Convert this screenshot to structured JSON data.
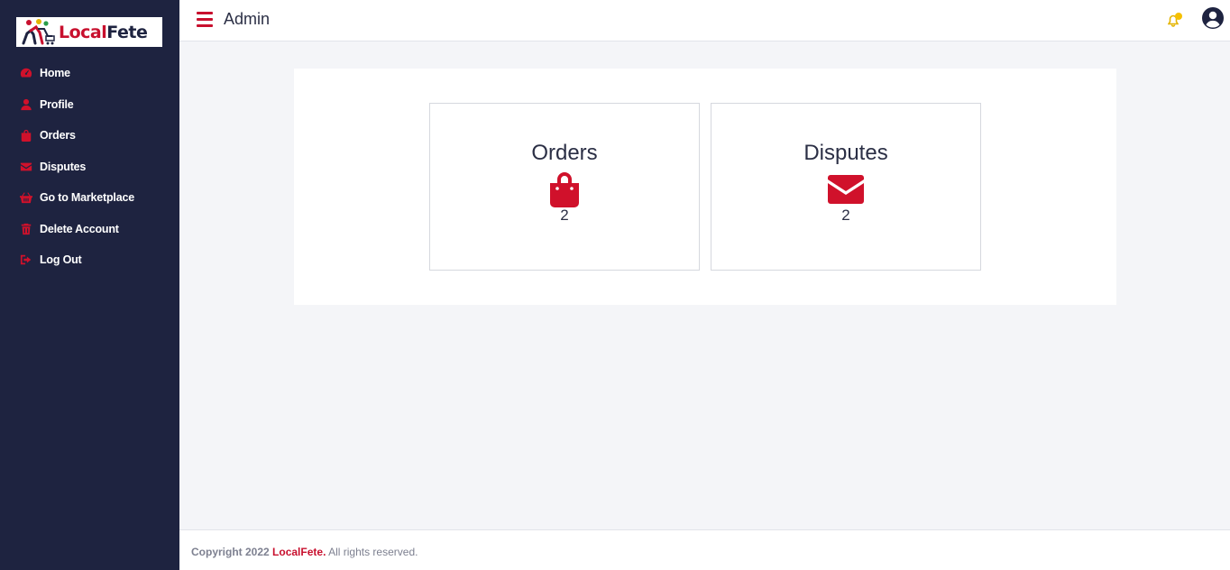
{
  "brand": {
    "part1": "Local",
    "part2": "Fete"
  },
  "colors": {
    "sidebar_bg": "#1e2340",
    "accent": "#d0112b",
    "notification": "#f5c000",
    "page_bg": "#f4f5f8"
  },
  "sidebar": {
    "items": [
      {
        "label": "Home",
        "icon": "dashboard-icon"
      },
      {
        "label": "Profile",
        "icon": "user-icon"
      },
      {
        "label": "Orders",
        "icon": "shopping-bag-icon"
      },
      {
        "label": "Disputes",
        "icon": "envelope-icon"
      },
      {
        "label": "Go to Marketplace",
        "icon": "basket-icon"
      },
      {
        "label": "Delete Account",
        "icon": "trash-icon"
      },
      {
        "label": "Log Out",
        "icon": "sign-out-icon"
      }
    ]
  },
  "header": {
    "title": "Admin",
    "menu_icon": "hamburger-icon",
    "notification_icon": "bell-icon",
    "account_icon": "user-circle-icon"
  },
  "cards": [
    {
      "title": "Orders",
      "icon": "shopping-bag-icon",
      "count": "2"
    },
    {
      "title": "Disputes",
      "icon": "envelope-icon",
      "count": "2"
    }
  ],
  "footer": {
    "prefix": "Copyright 2022",
    "brand": "LocalFete.",
    "suffix": "All rights reserved."
  }
}
